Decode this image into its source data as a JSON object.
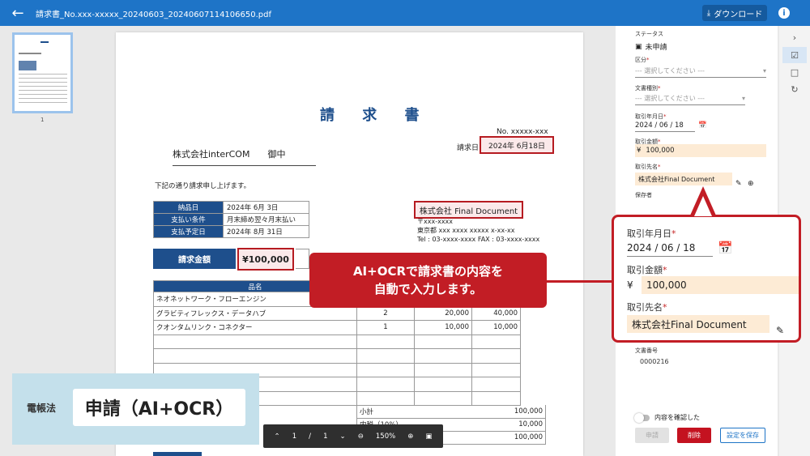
{
  "topbar": {
    "back_icon": "arrow-left-icon",
    "filename": "請求書_No.xxx-xxxxx_20240603_20240607114106650.pdf",
    "download_label": "ダウンロード",
    "info_icon": "info-icon"
  },
  "thumbnails": {
    "page_number": "1"
  },
  "document": {
    "title": "請 求 書",
    "number": "No. xxxxx-xxx",
    "date_label": "請求日",
    "date_value": "2024年 6月18日",
    "recipient": "株式会社interCOM　　御中",
    "intro": "下記の通り請求申し上げます。",
    "info_rows": [
      {
        "key": "納品日",
        "value": "2024年 6月 3日"
      },
      {
        "key": "支払い条件",
        "value": "月末締め翌々月末払い"
      },
      {
        "key": "支払予定日",
        "value": "2024年 8月 31日"
      }
    ],
    "supplier": {
      "name": "株式会社 Final Document",
      "postal": "〒xxx-xxxx",
      "address": "東京都 xxx xxxx xxxxx x-xx-xx",
      "phone": "Tel : 03-xxxx-xxxx FAX : 03-xxxx-xxxx"
    },
    "amount_label": "請求金額",
    "amount_value": "¥100,000",
    "items_header": "品名",
    "items": [
      {
        "name": "ネオネットワーク・フローエンジン",
        "qty": "",
        "price": "",
        "total": ""
      },
      {
        "name": "グラビティフレックス・データハブ",
        "qty": "2",
        "price": "20,000",
        "total": "40,000"
      },
      {
        "name": "クオンタムリンク・コネクター",
        "qty": "1",
        "price": "10,000",
        "total": "10,000"
      }
    ],
    "totals": [
      {
        "key": "小計",
        "value": "100,000"
      },
      {
        "key": "内税（10%）",
        "value": "10,000"
      },
      {
        "key": "",
        "value": "100,000"
      }
    ]
  },
  "zoombar": {
    "page_current": "1",
    "page_sep": "/",
    "page_total": "1",
    "zoom": "150%"
  },
  "panel": {
    "status_label": "ステータス",
    "status_value": "未申請",
    "category_label": "区分",
    "category_placeholder": "--- 選択してください ---",
    "doctype_label": "文書種別",
    "doctype_placeholder": "--- 選択してください ---",
    "date_label": "取引年月日",
    "date_value": "2024 / 06 / 18",
    "amount_label": "取引金額",
    "currency": "¥",
    "amount_value": "100,000",
    "partner_label": "取引先名",
    "partner_value": "株式会社Final Document",
    "keeper_label": "保存者",
    "docno_label": "文書番号",
    "docno_value": "0000216",
    "confirm_label": "内容を確認した",
    "apply_label": "申請",
    "reject_label": "削除",
    "save_label": "設定を保存",
    "required_mark": "*"
  },
  "callout": {
    "line1": "AI+OCRで請求書の内容を",
    "line2": "自動で入力します。"
  },
  "badge": {
    "small": "電帳法",
    "main": "申請（AI+OCR）"
  },
  "colors": {
    "topbar": "#1e74c7",
    "accent_red": "#c21d25",
    "table_header": "#1e4f8c",
    "badge_bg": "#c4e0eb"
  }
}
